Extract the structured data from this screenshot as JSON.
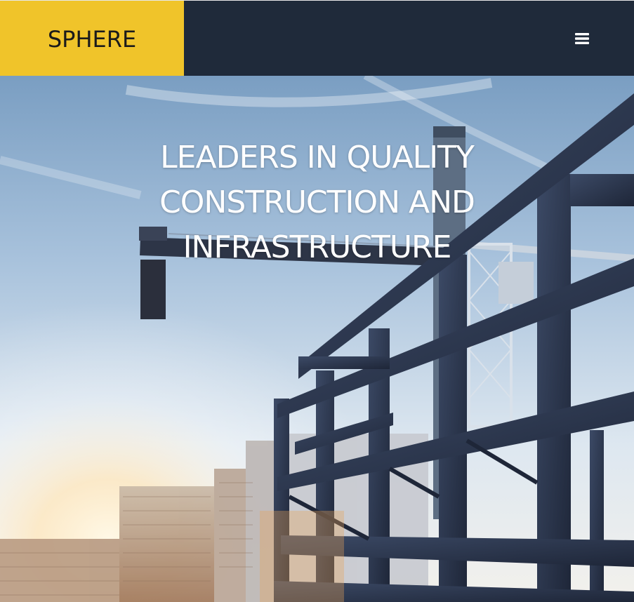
{
  "header": {
    "logo_text": "SPHERE",
    "menu_icon": "hamburger-menu-icon",
    "colors": {
      "bar": "#1f2a3a",
      "logo_bg": "#f0c42a",
      "logo_text": "#1b1b1b"
    }
  },
  "hero": {
    "title": "LEADERS IN QUALITY CONSTRUCTION AND INFRASTRUCTURE",
    "title_color": "#ffffff",
    "image": "construction-site-steel-frame-crane-image"
  }
}
